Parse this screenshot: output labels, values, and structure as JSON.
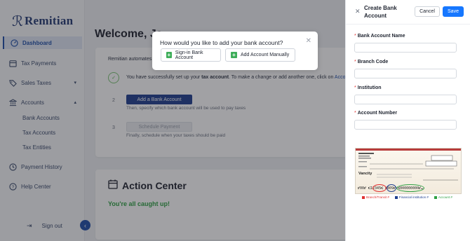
{
  "app": {
    "logo_text": "Remitian"
  },
  "sidebar": {
    "items": [
      {
        "label": "Dashboard",
        "icon": "dashboard-icon"
      },
      {
        "label": "Tax Payments",
        "icon": "calendar-icon"
      },
      {
        "label": "Sales Taxes",
        "icon": "tag-icon"
      },
      {
        "label": "Accounts",
        "icon": "bank-icon"
      },
      {
        "label": "Payment History",
        "icon": "history-icon"
      },
      {
        "label": "Help Center",
        "icon": "help-icon"
      }
    ],
    "sub_items": [
      "Bank Accounts",
      "Tax Accounts",
      "Tax Entities"
    ],
    "signout_label": "Sign out"
  },
  "main": {
    "welcome": "Welcome, Ja",
    "intro": "Remitian automates",
    "step1_prefix": "You have successfully set up your ",
    "step1_bold": "tax account",
    "step1_suffix": ". To make a change or add another one, click on ",
    "step1_link": "Accoun",
    "step2_num": "2",
    "step2_button": "Add a Bank Account",
    "step2_text": "Then, specify which bank account will be used to pay taxes",
    "step3_num": "3",
    "step3_button": "Schedule Payment",
    "step3_text": "Finally, schedule when your taxes should be paid",
    "action_center_title": "Action Center",
    "action_center_status": "You're all caught up!"
  },
  "popover": {
    "title": "How would you like to add your bank account?",
    "option1": "Sign-in Bank Account",
    "option2": "Add Account Manually"
  },
  "drawer": {
    "title": "Create Bank Account",
    "cancel_label": "Cancel",
    "save_label": "Save",
    "fields": [
      {
        "label": "Bank Account Name",
        "value": ""
      },
      {
        "label": "Branch Code",
        "value": ""
      },
      {
        "label": "Institution",
        "value": ""
      },
      {
        "label": "Account Number",
        "value": ""
      }
    ],
    "required_marker": "*"
  },
  "cheque": {
    "bank_name": "Vancity",
    "micr_line": "⑈00⑈ ⑆12345⑆ ⑈809⑈ ⑆000000000⑈⑉",
    "legend": [
      {
        "label": "Branch/Transit #",
        "color": "#e03131"
      },
      {
        "label": "Financial institution #",
        "color": "#1f3f8f"
      },
      {
        "label": "Account #",
        "color": "#2ea043"
      }
    ]
  },
  "colors": {
    "brand": "#233a73",
    "primary": "#1677ff",
    "success": "#2ea043",
    "danger": "#e03131"
  }
}
